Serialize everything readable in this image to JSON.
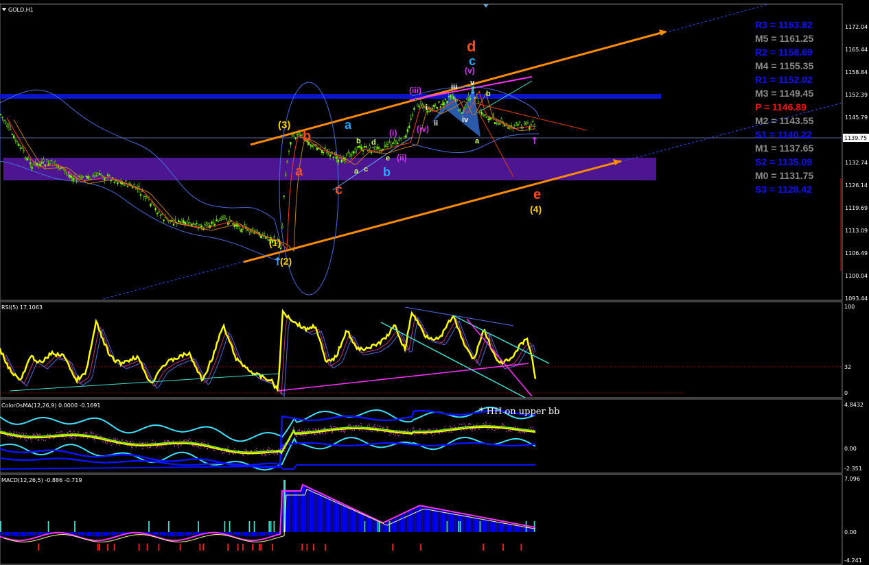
{
  "symbol_header": "GOLD,H1",
  "price_axis": [
    "1172.04",
    "1165.44",
    "1158.84",
    "1152.39",
    "1145.79",
    "1139.75",
    "1132.74",
    "1126.14",
    "1119.69",
    "1113.09",
    "1106.49",
    "1100.04",
    "1093.44"
  ],
  "current_price": "1139.75",
  "pivot_levels": [
    {
      "label": "R3 = 1163.82",
      "color": "#1010ff"
    },
    {
      "label": "M5 = 1161.25",
      "color": "#8c8c8c"
    },
    {
      "label": "R2 = 1158.69",
      "color": "#1010ff"
    },
    {
      "label": "M4 = 1155.35",
      "color": "#8c8c8c"
    },
    {
      "label": "R1 = 1152.02",
      "color": "#1010ff"
    },
    {
      "label": "M3 = 1149.45",
      "color": "#8c8c8c"
    },
    {
      "label": "P  = 1146.89",
      "color": "#ff1010"
    },
    {
      "label": "M2 = 1143.55",
      "color": "#8c8c8c"
    },
    {
      "label": "S1 = 1140.22",
      "color": "#1010ff"
    },
    {
      "label": "M1 = 1137.65",
      "color": "#8c8c8c"
    },
    {
      "label": "S2 = 1135.09",
      "color": "#1010ff"
    },
    {
      "label": "M0 = 1131.75",
      "color": "#8c8c8c"
    },
    {
      "label": "S3 = 1128.42",
      "color": "#1010ff"
    }
  ],
  "wave_labels": {
    "w3": "(3)",
    "w1": "(1)",
    "w2": "(2)",
    "w4": "(4)",
    "a_red": "a",
    "b_red": "b",
    "c_red": "c",
    "d_red": "d",
    "e_red": "e",
    "a_blue": "a",
    "b_blue": "b",
    "c_blue": "c",
    "b_small": "b",
    "d_small": "d",
    "a_small": "a",
    "c_small": "c",
    "e_small": "e",
    "i_m": "(i)",
    "ii_m": "(ii)",
    "iii_m": "(iii)",
    "iv_m": "(iv)",
    "v_m": "(v)",
    "i_w": "i",
    "ii_w": "ii",
    "iii_w": "iii",
    "iv_w": "iv",
    "v_w": "v",
    "a_g": "a",
    "b_g": "b"
  },
  "rsi": {
    "header": "RSI(5) 17.1063",
    "axis": [
      "100",
      "32",
      "0"
    ]
  },
  "colorosma": {
    "header": "ColorOsMA(12,26,9) 0.0000 -0.1691",
    "axis": [
      "4.8432",
      "0.00",
      "-2.351"
    ],
    "note": "* HH on upper bb"
  },
  "macd": {
    "header": "MACD(12,26,5) -0.886 -0.719",
    "axis": [
      "7.096",
      "0.00",
      "-4.241"
    ]
  },
  "colors": {
    "bg": "#000000",
    "bull": "#7cfc00",
    "channel": "#ff8c00",
    "resistance": "#0000cc",
    "support": "#5b1ea0",
    "rsi": "#ffff00",
    "macd_hist": "#0000ff"
  }
}
